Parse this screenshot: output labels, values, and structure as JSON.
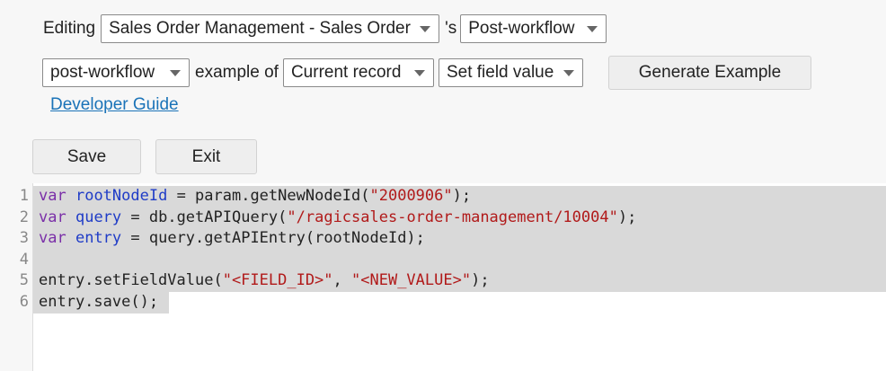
{
  "toolbar": {
    "editing_label": "Editing",
    "sheet_select": "Sales Order Management - Sales Order",
    "possessive": "'s",
    "trigger_select": "Post-workflow",
    "type_select": "post-workflow",
    "example_of_label": "example of",
    "record_select": "Current record",
    "action_select": "Set field value",
    "generate_button": "Generate Example",
    "dev_guide_link": "Developer Guide"
  },
  "actions": {
    "save_label": "Save",
    "exit_label": "Exit"
  },
  "editor": {
    "line_numbers": [
      "1",
      "2",
      "3",
      "4",
      "5",
      "6"
    ],
    "lines": [
      {
        "kw": "var",
        "name": "rootNodeId",
        "rest1": " = param.getNewNodeId(",
        "str": "\"2000906\"",
        "rest2": ");"
      },
      {
        "kw": "var",
        "name": "query",
        "rest1": " = db.getAPIQuery(",
        "str": "\"/ragicsales-order-management/10004\"",
        "rest2": ");"
      },
      {
        "kw": "var",
        "name": "entry",
        "rest1": " = query.getAPIEntry(rootNodeId);",
        "str": "",
        "rest2": ""
      },
      {
        "plain": ""
      },
      {
        "pre": "entry.setFieldValue(",
        "str1": "\"<FIELD_ID>\"",
        "mid": ", ",
        "str2": "\"<NEW_VALUE>\"",
        "post": ");"
      },
      {
        "plain": "entry.save();"
      }
    ]
  },
  "colors": {
    "keyword": "#7a2fa8",
    "variable": "#1f3cc7",
    "string": "#b11a1a",
    "selection": "#d9d9d9",
    "link": "#1a73b8"
  }
}
